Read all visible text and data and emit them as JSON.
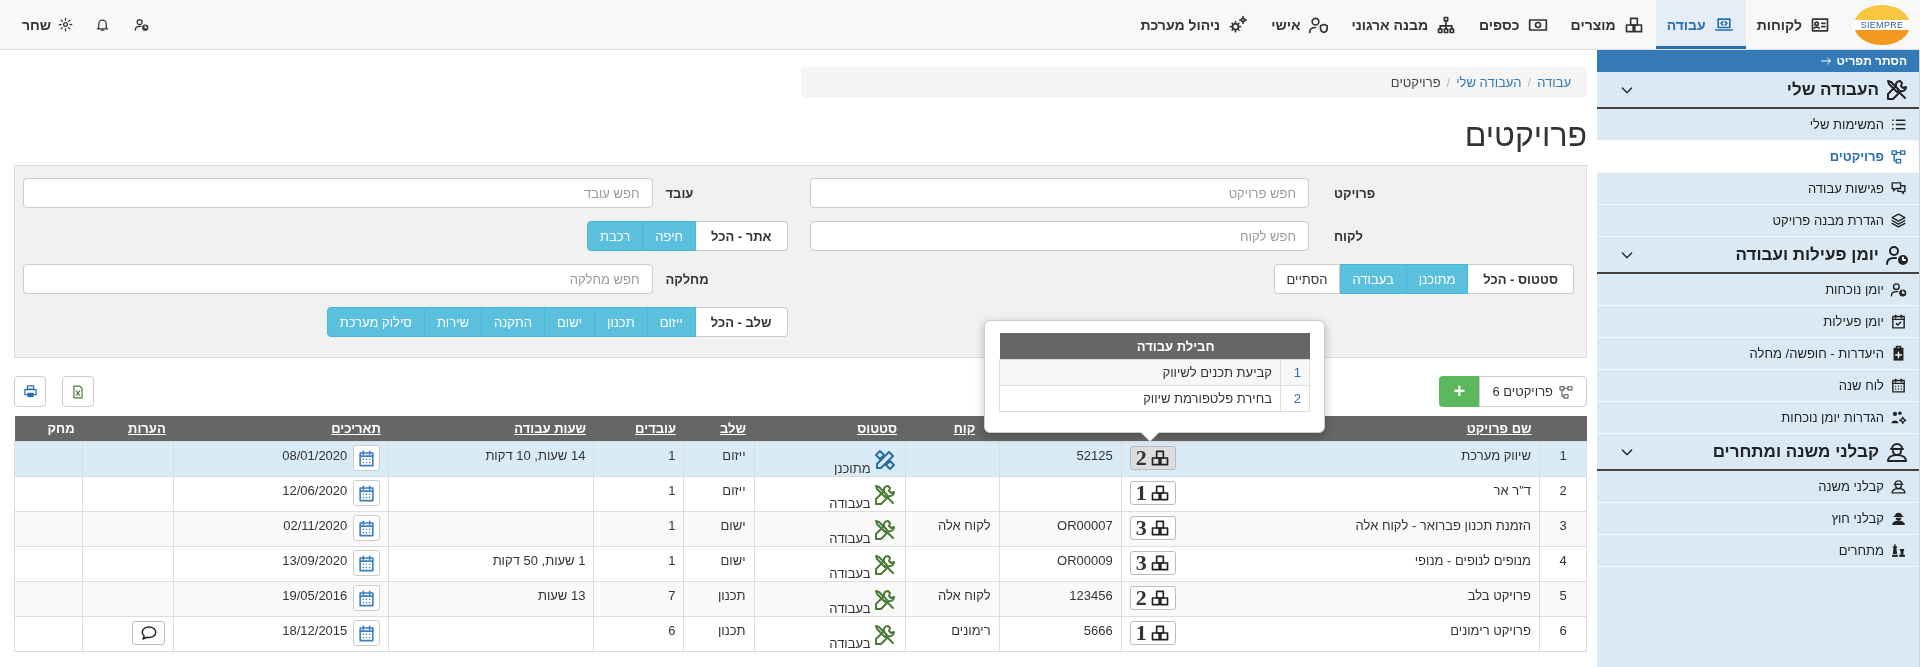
{
  "logo": {
    "text": "SIEMPRE"
  },
  "nav": [
    {
      "label": "לקוחות",
      "selected": false
    },
    {
      "label": "עבודה",
      "selected": true
    },
    {
      "label": "מוצרים",
      "selected": false
    },
    {
      "label": "כספים",
      "selected": false
    },
    {
      "label": "מבנה ארגוני",
      "selected": false
    },
    {
      "label": "אישי",
      "selected": false
    },
    {
      "label": "ניהול מערכת",
      "selected": false
    }
  ],
  "user": {
    "name": "שחר"
  },
  "sidebar": {
    "hide_label": "הסתר תפריט",
    "sections": [
      {
        "title": "העבודה שלי",
        "expanded": true,
        "items": [
          {
            "label": "המשימות שלי",
            "selected": false
          },
          {
            "label": "פרויקטים",
            "selected": true
          },
          {
            "label": "פגישות עבודה",
            "selected": false
          },
          {
            "label": "הגדרת מבנה פרויקט",
            "selected": false
          }
        ]
      },
      {
        "title": "יומן פעילות ועבודה",
        "expanded": true,
        "items": [
          {
            "label": "יומן נוכחות",
            "selected": false
          },
          {
            "label": "יומן פעילות",
            "selected": false
          },
          {
            "label": "היעדרות - חופשה/ מחלה",
            "selected": false
          },
          {
            "label": "לוח שנה",
            "selected": false
          },
          {
            "label": "הגדרות יומן נוכחות",
            "selected": false
          }
        ]
      },
      {
        "title": "קבלני משנה ומתחרים",
        "expanded": true,
        "items": [
          {
            "label": "קבלני משנה",
            "selected": false
          },
          {
            "label": "קבלני חוץ",
            "selected": false
          },
          {
            "label": "מתחרים",
            "selected": false
          }
        ]
      }
    ]
  },
  "breadcrumb": {
    "separator": "/",
    "items": [
      {
        "label": "עבודה",
        "current": false
      },
      {
        "label": "העבודה שלי",
        "current": false
      },
      {
        "label": "פרויקטים",
        "current": true
      }
    ]
  },
  "title": "פרויקטים",
  "filters": {
    "columns": [
      [
        {
          "kind": "field",
          "label": "פרויקט",
          "placeholder": "חפש פרויקט"
        },
        {
          "kind": "field",
          "label": "לקוח",
          "placeholder": "חפש לקוח"
        },
        {
          "kind": "toggle",
          "options": [
            {
              "label": "סטטוס - הכל",
              "selected": false
            },
            {
              "label": "מתוכנן",
              "selected": true
            },
            {
              "label": "בעבודה",
              "selected": true
            },
            {
              "label": "הסתיים",
              "selected": false
            }
          ]
        }
      ],
      [
        {
          "kind": "field",
          "label": "עובד",
          "placeholder": "חפש עובד"
        },
        {
          "kind": "toggle",
          "options": [
            {
              "label": "אתר - הכל",
              "selected": false
            },
            {
              "label": "חיפה",
              "selected": true
            },
            {
              "label": "רכבת",
              "selected": true
            }
          ]
        },
        {
          "kind": "field",
          "label": "מחלקה",
          "placeholder": "חפש מחלקה"
        },
        {
          "kind": "toggle",
          "options": [
            {
              "label": "שלב - הכל",
              "selected": false
            },
            {
              "label": "ייזום",
              "selected": true
            },
            {
              "label": "תכנון",
              "selected": true
            },
            {
              "label": "ישום",
              "selected": true
            },
            {
              "label": "התקנה",
              "selected": true
            },
            {
              "label": "שירות",
              "selected": true
            },
            {
              "label": "סילוק מערכת",
              "selected": true
            }
          ]
        }
      ]
    ]
  },
  "toolbar": {
    "count_label": "פרויקטים 6",
    "add_label": "+"
  },
  "table": {
    "columns": [
      {
        "label": "שם פרויקט",
        "sortable": true
      },
      {
        "label": "קוח",
        "sortable": true
      },
      {
        "label": "סטטוס",
        "sortable": true
      },
      {
        "label": "שלב",
        "sortable": true
      },
      {
        "label": "עובדים",
        "sortable": true
      },
      {
        "label": "שעות עבודה",
        "sortable": true
      },
      {
        "label": "תאריכים",
        "sortable": true
      },
      {
        "label": "הערות",
        "sortable": true
      },
      {
        "label": "מחק",
        "sortable": false
      }
    ],
    "rows": [
      {
        "num": "1",
        "name": "שיווק מערכת",
        "packages": "2",
        "packages_open": true,
        "column_3": "52125",
        "status": {
          "kind": "planned",
          "label": "מתוכנן"
        },
        "stage": "ייזום",
        "workers": "1",
        "hours": "14 שעות, 10 דקות",
        "date": "08/01/2020",
        "has_comment": false,
        "selected": true
      },
      {
        "num": "2",
        "name": "ד\"ר אר",
        "packages": "1",
        "packages_open": false,
        "status": {
          "kind": "working",
          "label": "בעבודה"
        },
        "stage": "ייזום",
        "workers": "1",
        "date": "12/06/2020",
        "has_comment": false,
        "selected": false
      },
      {
        "num": "3",
        "name": "הזמנת תכנון פברואר - לקוח אלה",
        "packages": "3",
        "packages_open": false,
        "column_3": "OR00007",
        "client": "לקוח אלה",
        "status": {
          "kind": "working",
          "label": "בעבודה"
        },
        "stage": "ישום",
        "workers": "1",
        "date": "02/11/2020",
        "has_comment": false,
        "selected": false
      },
      {
        "num": "4",
        "name": "מנופים לנופים - מנופי",
        "packages": "3",
        "packages_open": false,
        "column_3": "OR00009",
        "status": {
          "kind": "working",
          "label": "בעבודה"
        },
        "stage": "ישום",
        "workers": "1",
        "hours": "1 שעות, 50 דקות",
        "date": "13/09/2020",
        "has_comment": false,
        "selected": false
      },
      {
        "num": "5",
        "name": "פרויקט בלב",
        "packages": "2",
        "packages_open": false,
        "column_3": "123456",
        "client": "לקוח אלה",
        "status": {
          "kind": "working",
          "label": "בעבודה"
        },
        "stage": "תכנון",
        "workers": "7",
        "hours": "13 שעות",
        "date": "19/05/2016",
        "has_comment": false,
        "selected": false
      },
      {
        "num": "6",
        "name": "פרויקט רימונים",
        "packages": "1",
        "packages_open": false,
        "column_3": "5666",
        "client": "רימונים",
        "status": {
          "kind": "working",
          "label": "בעבודה"
        },
        "stage": "תכנון",
        "workers": "6",
        "date": "18/12/2015",
        "has_comment": true,
        "selected": false
      }
    ]
  },
  "popover": {
    "title": "חבילת עבודה",
    "rows": [
      {
        "num": "1",
        "name": "קביעת תכנים לשיווק"
      },
      {
        "num": "2",
        "name": "בחירת פלטפורמת שיווק"
      }
    ]
  }
}
